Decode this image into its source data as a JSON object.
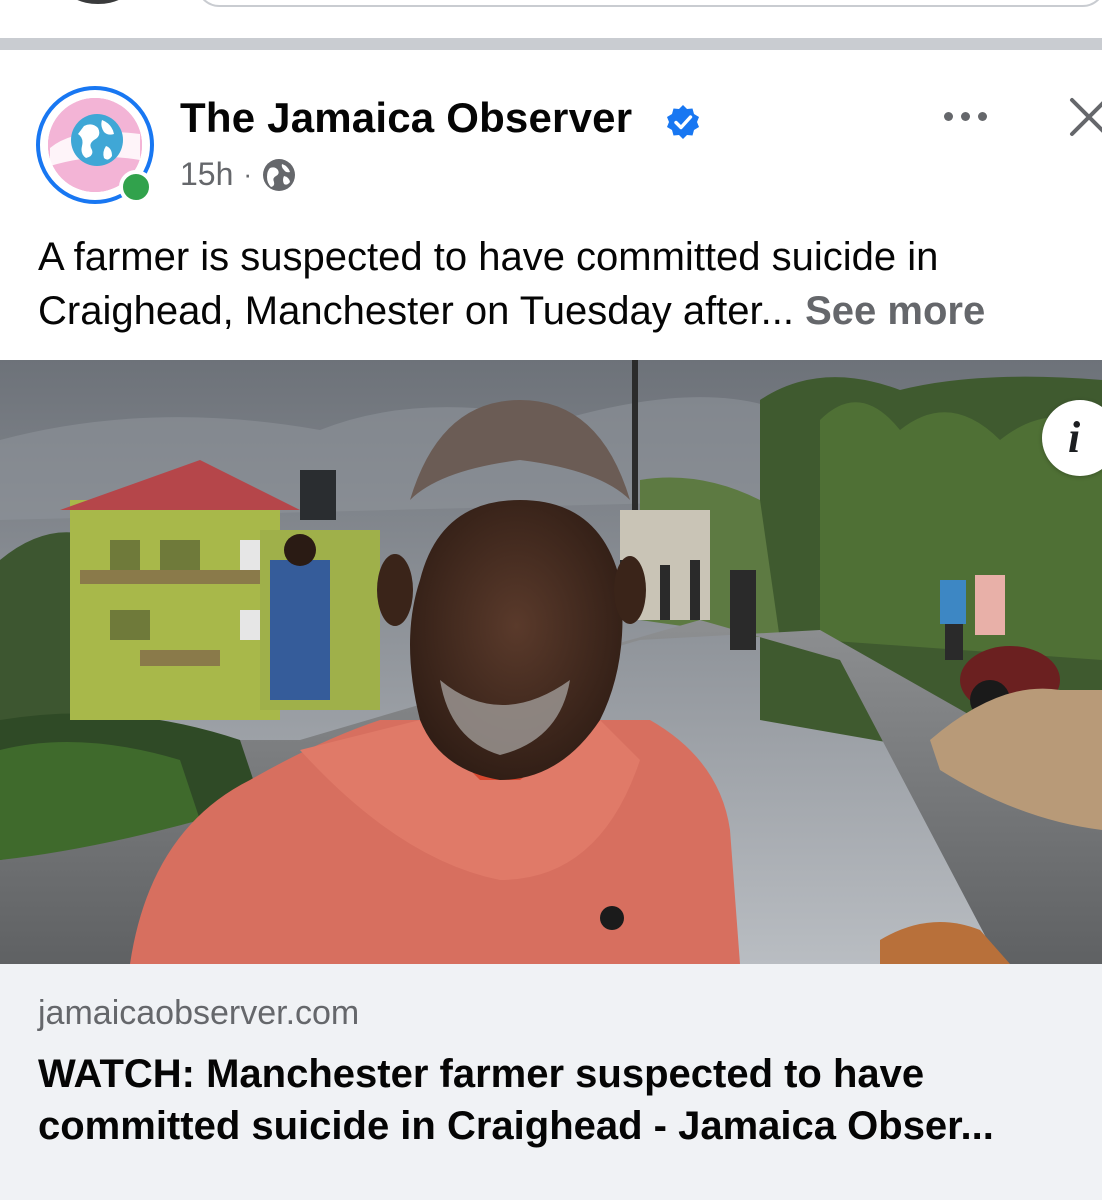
{
  "post": {
    "page_name": "The Jamaica Observer",
    "verified_icon": "verified-badge-icon",
    "timestamp": "15h",
    "separator": "·",
    "audience_icon": "globe-icon",
    "text_line_1": "A farmer is suspected to have committed suicide in",
    "text_line_2": "Craighead, Manchester on Tuesday after...",
    "see_more": "See more",
    "more_icon": "more-options-icon",
    "close_icon": "close-icon"
  },
  "media": {
    "info_label": "i",
    "info_icon": "info-icon"
  },
  "link": {
    "domain": "jamaicaobserver.com",
    "title_line_1": "WATCH: Manchester farmer suspected to have",
    "title_line_2": "committed suicide in Craighead - Jamaica Obser..."
  },
  "colors": {
    "verified_blue": "#1877f2",
    "online_green": "#31a24c",
    "secondary_text": "#65676b",
    "divider": "#c9ccd1",
    "link_bg": "#f0f2f5"
  }
}
